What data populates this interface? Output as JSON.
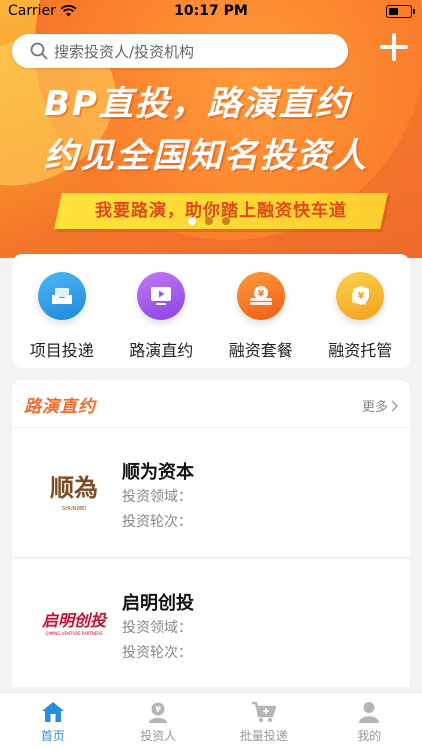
{
  "status_bar": {
    "carrier": "Carrier",
    "time": "10:17 PM"
  },
  "search": {
    "placeholder": "搜索投资人/投资机构"
  },
  "banner": {
    "headline1": "BP直投，路演直约",
    "headline2": "约见全国知名投资人",
    "slogan": "我要路演，助你踏上融资快车道",
    "slide_count": 3,
    "active_slide": 1
  },
  "quick_actions": [
    {
      "label": "项目投递",
      "icon": "inbox-tray-icon",
      "color": "#2c9be6"
    },
    {
      "label": "路演直约",
      "icon": "play-video-icon",
      "color": "#9b57e8"
    },
    {
      "label": "融资套餐",
      "icon": "coin-stack-icon",
      "color": "#f2761f"
    },
    {
      "label": "融资托管",
      "icon": "yuan-shield-icon",
      "color": "#f5b231"
    }
  ],
  "roadshow": {
    "title": "路演直约",
    "more_label": "更多",
    "items": [
      {
        "name": "顺为资本",
        "field_label": "投资领域：",
        "round_label": "投资轮次：",
        "logo_text": "顺為",
        "logo_subtext": "SHUNWEI"
      },
      {
        "name": "启明创投",
        "field_label": "投资领域：",
        "round_label": "投资轮次：",
        "logo_text": "启明创投",
        "logo_subtext": "QIMING VENTURE PARTNERS"
      }
    ]
  },
  "tab_bar": {
    "tabs": [
      {
        "label": "首页",
        "icon": "home-icon",
        "active": true
      },
      {
        "label": "投资人",
        "icon": "investor-icon",
        "active": false
      },
      {
        "label": "批量投递",
        "icon": "cart-icon",
        "active": false
      },
      {
        "label": "我的",
        "icon": "user-icon",
        "active": false
      }
    ]
  },
  "colors": {
    "accent": "#f26d2b",
    "tab_active": "#2a8de3",
    "banner_ribbon": "#fde23a"
  }
}
